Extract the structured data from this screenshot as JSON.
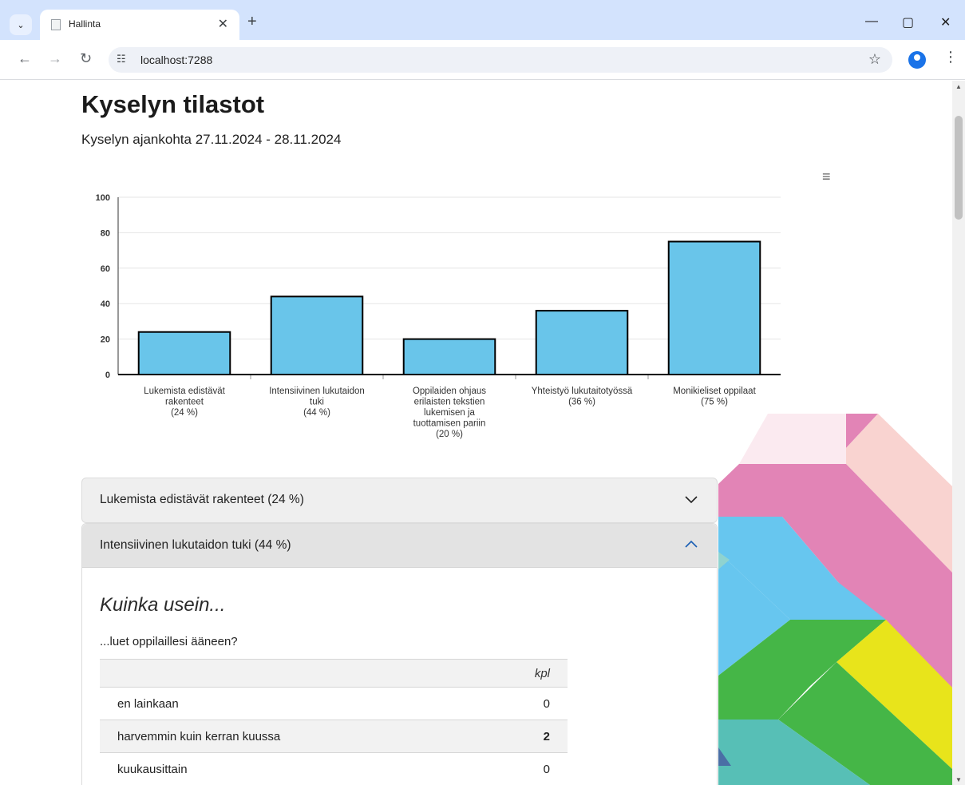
{
  "browser": {
    "tab_title": "Hallinta",
    "url": "localhost:7288"
  },
  "page": {
    "title": "Kyselyn tilastot",
    "subtitle": "Kyselyn ajankohta 27.11.2024 - 28.11.2024"
  },
  "chart_data": {
    "type": "bar",
    "categories": [
      "Lukemista edistävät rakenteet",
      "Intensiivinen lukutaidon tuki",
      "Oppilaiden ohjaus erilaisten tekstien lukemisen ja tuottamisen pariin",
      "Yhteistyö lukutaitotyössä",
      "Monikieliset oppilaat"
    ],
    "category_label_lines": [
      [
        "Lukemista edistävät",
        "rakenteet",
        "(24 %)"
      ],
      [
        "Intensiivinen lukutaidon",
        "tuki",
        "(44 %)"
      ],
      [
        "Oppilaiden ohjaus",
        "erilaisten tekstien",
        "lukemisen ja",
        "tuottamisen pariin",
        "(20 %)"
      ],
      [
        "Yhteistyö lukutaitotyössä",
        "(36 %)"
      ],
      [
        "Monikieliset oppilaat",
        "(75 %)"
      ]
    ],
    "values": [
      24,
      44,
      20,
      36,
      75
    ],
    "ylim": [
      0,
      100
    ],
    "yticks": [
      0,
      20,
      40,
      60,
      80,
      100
    ],
    "grid": true,
    "colors": {
      "bar": "#69c5ea",
      "outline": "#000000"
    }
  },
  "accordions": [
    {
      "label": "Lukemista edistävät rakenteet (24 %)",
      "expanded": false
    },
    {
      "label": "Intensiivinen lukutaidon tuki (44 %)",
      "expanded": true
    }
  ],
  "section": {
    "title": "Kuinka usein...",
    "question": "...luet oppilaillesi ääneen?",
    "table": {
      "count_header": "kpl",
      "rows": [
        {
          "label": "en lainkaan",
          "count": "0"
        },
        {
          "label": "harvemmin kuin kerran kuussa",
          "count": "2"
        },
        {
          "label": "kuukausittain",
          "count": "0"
        }
      ]
    }
  }
}
